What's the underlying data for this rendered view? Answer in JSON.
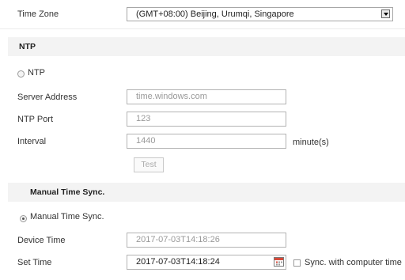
{
  "time_zone": {
    "label": "Time Zone",
    "selected": "(GMT+08:00) Beijing, Urumqi, Singapore"
  },
  "ntp": {
    "section_title": "NTP",
    "radio_label": "NTP",
    "radio_checked": false,
    "server_address": {
      "label": "Server Address",
      "value": "time.windows.com"
    },
    "ntp_port": {
      "label": "NTP Port",
      "value": "123"
    },
    "interval": {
      "label": "Interval",
      "value": "1440",
      "unit": "minute(s)"
    },
    "test_button": "Test"
  },
  "manual": {
    "section_title": "Manual Time Sync.",
    "radio_label": "Manual Time Sync.",
    "radio_checked": true,
    "device_time": {
      "label": "Device Time",
      "value": "2017-07-03T14:18:26"
    },
    "set_time": {
      "label": "Set Time",
      "value": "2017-07-03T14:18:24"
    },
    "sync_label": "Sync. with computer time",
    "sync_checked": false
  },
  "icons": {
    "calendar": "calendar-icon",
    "dropdown": "chevron-down-icon"
  },
  "colors": {
    "section_bg": "#f3f3f3",
    "field_border": "#b3b3b3",
    "disabled_text": "#999999",
    "calendar_red": "#d64a3a"
  }
}
